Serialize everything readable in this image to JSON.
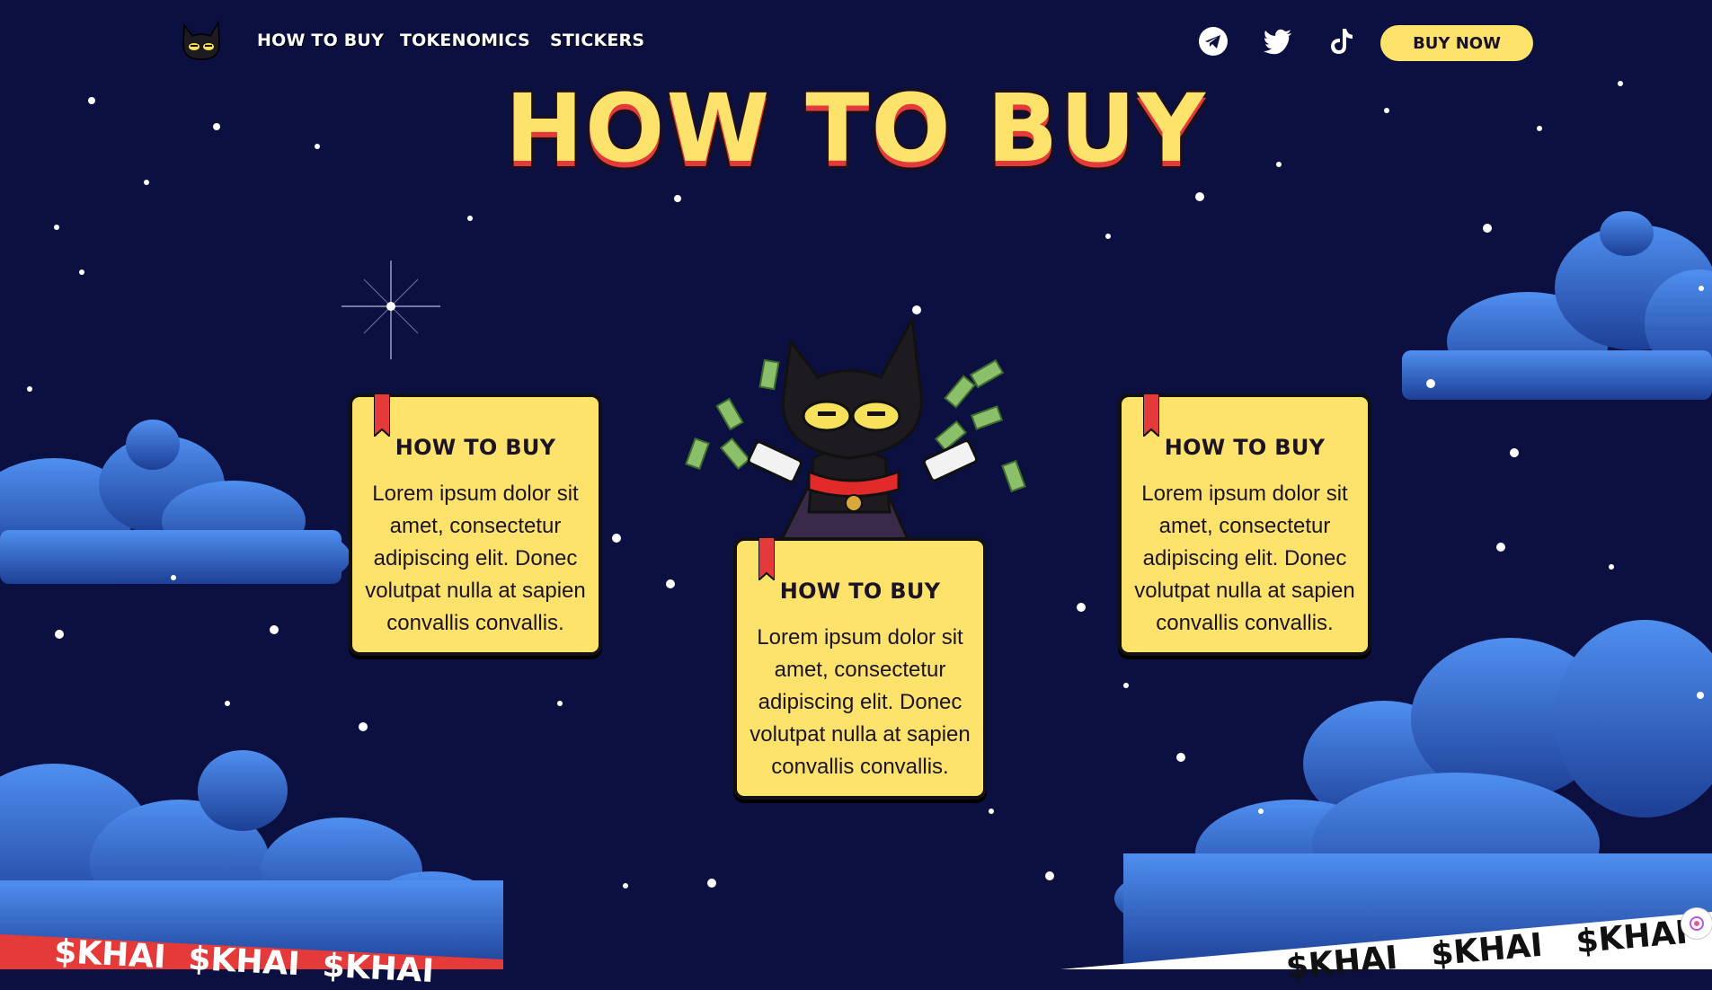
{
  "nav": {
    "links": [
      "HOW TO BUY",
      "TOKENOMICS",
      "STICKERS"
    ],
    "socials": [
      "telegram-icon",
      "twitter-icon",
      "tiktok-icon"
    ],
    "buy_label": "BUY NOW"
  },
  "hero": {
    "title": "HOW TO BUY"
  },
  "cards": [
    {
      "title": "HOW TO BUY",
      "text": "Lorem ipsum dolor sit amet, consectetur adipiscing elit. Donec volutpat nulla at sapien convallis convallis."
    },
    {
      "title": "HOW TO BUY",
      "text": "Lorem ipsum dolor sit amet, consectetur adipiscing elit. Donec volutpat nulla at sapien convallis convallis."
    },
    {
      "title": "HOW TO BUY",
      "text": "Lorem ipsum dolor sit amet, consectetur adipiscing elit. Donec volutpat nulla at sapien convallis convallis."
    }
  ],
  "ticker": {
    "left": "$KHAI  $KHAI  $KHAI",
    "right": "$KHAI   $KHAI   $KHAI   $KHAI"
  },
  "colors": {
    "background": "#0b1040",
    "accent": "#fde36c",
    "ribbon": "#e53a3a",
    "cloud": "#2f66c9"
  }
}
